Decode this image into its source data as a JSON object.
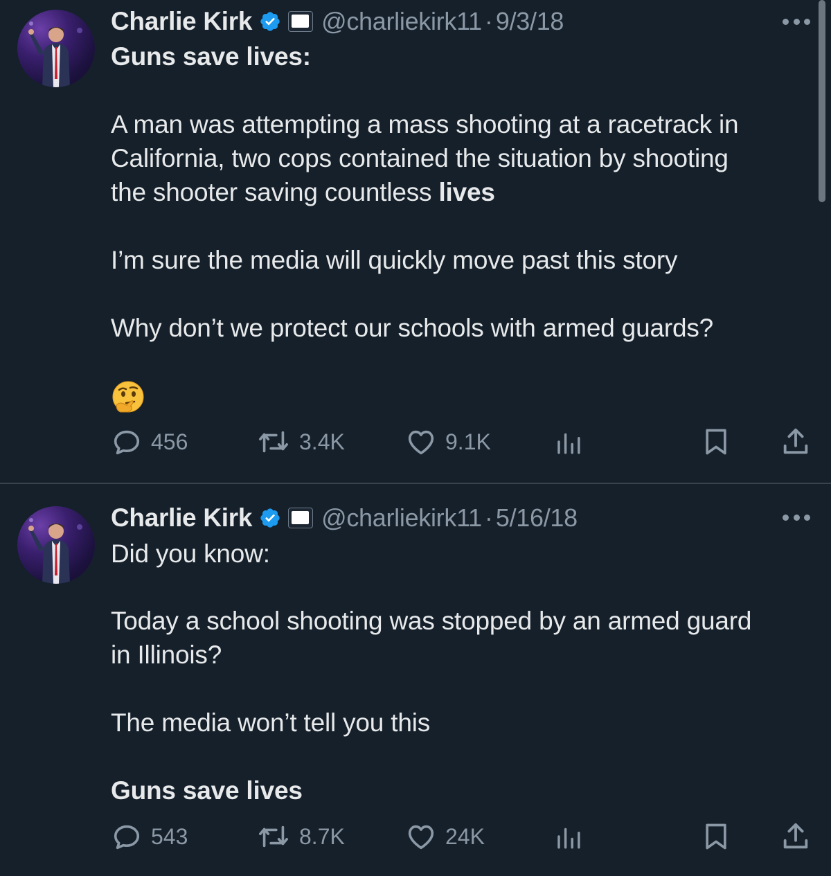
{
  "tweets": [
    {
      "author_name": "Charlie Kirk",
      "handle": "@charliekirk11",
      "separator": "·",
      "date": "9/3/18",
      "lines": [
        "Guns save lives:",
        "A man was attempting a mass shooting at a racetrack in",
        "California, two cops contained the situation by shooting",
        "the shooter saving countless ",
        "lives",
        "I’m sure the media will quickly move past this story",
        "Why don’t we protect our schools with armed guards?"
      ],
      "emoji": "thinking-face",
      "replies": "456",
      "reposts": "3.4K",
      "likes": "9.1K"
    },
    {
      "author_name": "Charlie Kirk",
      "handle": "@charliekirk11",
      "separator": "·",
      "date": "5/16/18",
      "lines": [
        "Did you know:",
        "Today a school shooting was stopped by an armed guard",
        "in Illinois?",
        "The media won’t tell you this",
        "Guns save lives"
      ],
      "replies": "543",
      "reposts": "8.7K",
      "likes": "24K"
    }
  ],
  "colors": {
    "background": "#15202b",
    "text": "#e7e9ea",
    "secondary": "#8b98a5",
    "verified": "#1d9bf0",
    "divider": "#38444d"
  },
  "icons": [
    "verified-badge-icon",
    "affiliate-badge-icon",
    "more-icon",
    "reply-icon",
    "repost-icon",
    "like-icon",
    "views-icon",
    "bookmark-icon",
    "share-icon"
  ]
}
